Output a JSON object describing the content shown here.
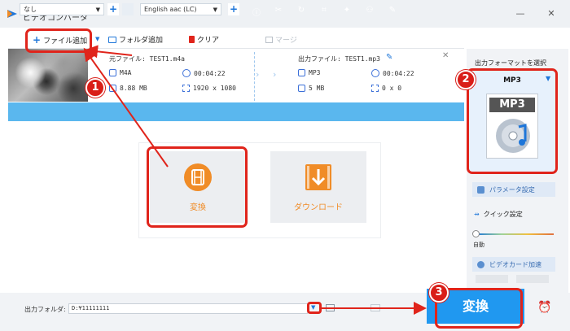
{
  "app": {
    "title": "ビデオコンバータ",
    "close_glyph": "✕",
    "min_glyph": "—"
  },
  "toolbar": {
    "add_file": "ファイル追加",
    "add_folder": "フォルダ追加",
    "clear": "クリア",
    "merge": "マージ"
  },
  "file": {
    "source_label": "元ファイル: TEST1.m4a",
    "source_format": "M4A",
    "source_duration": "00:04:22",
    "source_size": "8.88 MB",
    "source_resolution": "1920 x 1080",
    "output_label": "出力ファイル: TEST1.mp3",
    "output_format": "MP3",
    "output_duration": "00:04:22",
    "output_size": "5 MB",
    "output_resolution": "0 x 0"
  },
  "editbar": {
    "subtitle": "なし",
    "audio": "English aac (LC)"
  },
  "cards": {
    "convert": "変換",
    "download": "ダウンロード"
  },
  "sidebar": {
    "header": "出力フォーマットを選択",
    "format": "MP3",
    "format_icon_text": "MP3",
    "params": "パラメータ設定",
    "quick": "クイック設定",
    "auto": "自動",
    "gpu": "ビデオカード加速"
  },
  "bottom": {
    "folder_label": "出力フォルダ:",
    "path": "D:¥11111111",
    "convert": "変換"
  },
  "annotations": {
    "step1": "1",
    "step2": "2",
    "step3": "3"
  },
  "colors": {
    "accent": "#1e76d9",
    "bar": "#5ab7ee",
    "orange": "#f08c27",
    "highlight": "#e0241b",
    "convert": "#2098f0"
  }
}
